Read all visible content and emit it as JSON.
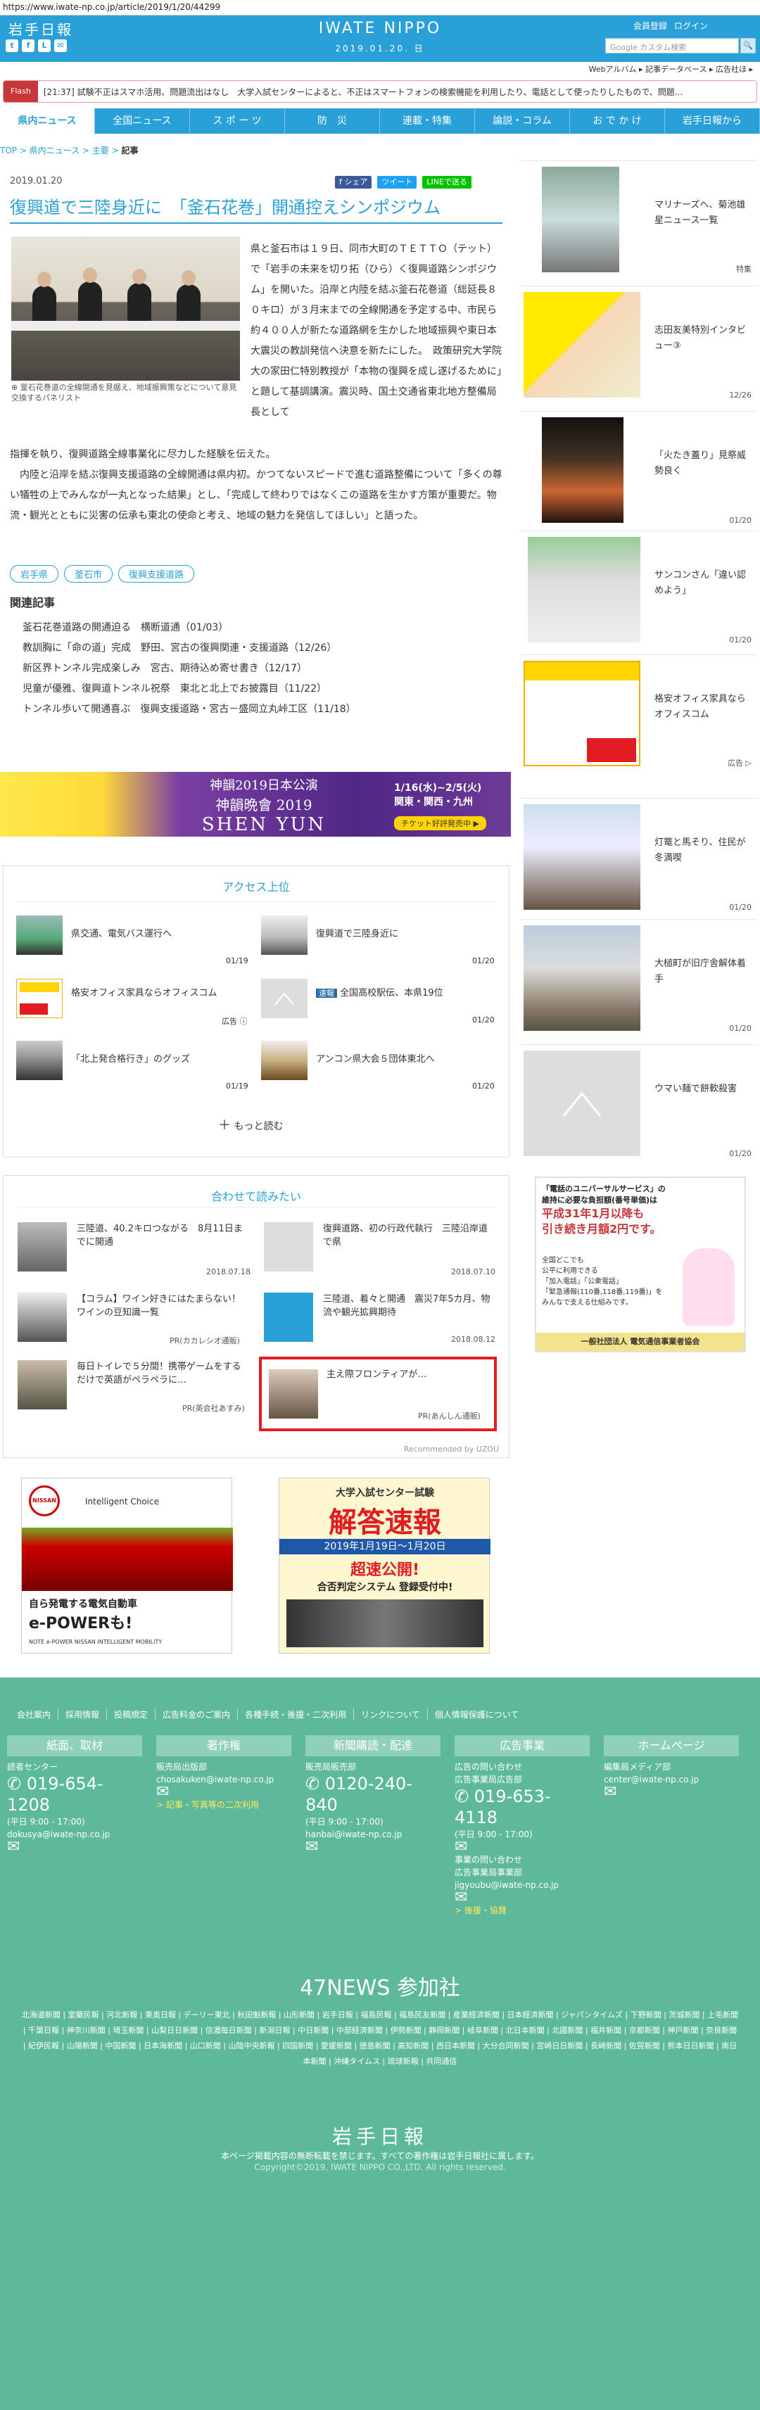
{
  "browser": {
    "url": "https://www.iwate-np.co.jp/article/2019/1/20/44299"
  },
  "header": {
    "logo": "岩手日報",
    "brand": "IWATE NIPPO",
    "date": "2019.01.20. 日",
    "links": [
      "会員登録",
      "ログイン"
    ],
    "search_placeholder": "Google カスタム検索",
    "search_button": "検索",
    "sublinks": "Webアルバム ▸ 記事データベース ▸ 広告社ほ ▸",
    "social_icons": [
      "twitter-icon",
      "facebook-icon",
      "line-icon",
      "mail-icon"
    ]
  },
  "flash": {
    "tag": "Flash",
    "text": "[21:37] 試験不正はスマホ活用、問題流出はなし　大学入試センターによると、不正はスマートフォンの検索機能を利用したり、電話として使ったりしたもので、問題..."
  },
  "nav": {
    "items": [
      "県内ニュース",
      "全国ニュース",
      "ス ポ ー ツ",
      "防　災",
      "連載・特集",
      "論説・コラム",
      "お で か け",
      "岩手日報から"
    ],
    "active_index": 0
  },
  "breadcrumb": {
    "items": [
      "TOP",
      "県内ニュース",
      "主要"
    ],
    "current": "記事"
  },
  "article": {
    "date": "2019.01.20",
    "share": [
      "f シェア",
      "ツイート",
      "LINEで送る"
    ],
    "title": "復興道で三陸身近に　「釜石花巻」開通控えシンポジウム",
    "caption": "釜石花巻道の全線開通を見据え、地域振興策などについて意見交換するパネリスト",
    "body1": "県と釜石市は１９日、同市大町のＴＥＴＴＯ（テット）で「岩手の未来を切り拓（ひら）く復興道路シンポジウム」を開いた。沿岸と内陸を結ぶ釜石花巻道（総延長８０キロ）が３月末までの全線開通を予定する中、市民ら約４００人が新たな道路網を生かした地域振興や東日本大震災の教訓発信へ決意を新たにした。　政策研究大学院大の家田仁特別教授が「本物の復興を成し遂げるために」と題して基調講演。震災時、国土交通省東北地方整備局長として",
    "body2": "指揮を執り、復興道路全線事業化に尽力した経験を伝えた。\n　内陸と沿岸を結ぶ復興支援道路の全線開通は県内初。かつてないスピードで進む道路整備について「多くの尊い犠牲の上でみんなが一丸となった結果」とし、「完成して終わりではなくこの道路を生かす方策が重要だ。物流・観光とともに災害の伝承も東北の使命と考え、地域の魅力を発信してほしい」と語った。",
    "tags": [
      "岩手県",
      "釜石市",
      "復興支援道路"
    ],
    "related_title": "関連記事",
    "related": [
      "釜石花巻道路の開通迫る　横断道通（01/03）",
      "教訓胸に「命の道」完成　野田、宮古の復興関連・支援道路（12/26）",
      "新区界トンネル完成楽しみ　宮古、期待込め寄せ書き（12/17）",
      "児童が優雅、復興道トンネル祝祭　東北と北上でお披露目（11/22）",
      "トンネル歩いて開通喜ぶ　復興支援道路・宮古－盛岡立丸峠工区（11/18）"
    ]
  },
  "banner": {
    "title": "神韻2019日本公演",
    "subtitle": "神韻晩會 2019",
    "name": "SHEN YUN",
    "dates": "1/16(水)~2/5(火)",
    "region": "関東・関西・九州",
    "button": "チケット好評発売中 ▶"
  },
  "access": {
    "title": "アクセス上位",
    "items": [
      {
        "text": "県交通、電気バス運行へ",
        "date": "01/19",
        "badge": ""
      },
      {
        "text": "復興道で三陸身近に",
        "date": "01/20",
        "badge": ""
      },
      {
        "text": "格安オフィス家具ならオフィスコム",
        "date": "広告 ⓘ",
        "badge": ""
      },
      {
        "text": "全国高校駅伝、本県19位",
        "date": "01/20",
        "badge": "速報"
      },
      {
        "text": "「北上発合格行き」のグッズ",
        "date": "01/19",
        "badge": ""
      },
      {
        "text": "アンコン県大会５団体東北へ",
        "date": "01/20",
        "badge": ""
      }
    ],
    "more": "もっと読む"
  },
  "also": {
    "title": "合わせて読みたい",
    "items": [
      {
        "text": "三陸道、40.2キロつながる　8月11日までに開通",
        "meta": "2018.07.18"
      },
      {
        "text": "復興道路、初の行政代執行　三陸沿岸道で県",
        "meta": "2018.07.10"
      },
      {
        "text": "【コラム】ワイン好きにはたまらない！ワインの豆知識一覧",
        "meta": "PR(カカレシオ通販)"
      },
      {
        "text": "三陸道、着々と開通　震災7年5カ月、物流や観光拡興期待",
        "meta": "2018.08.12"
      },
      {
        "text": "毎日トイレで５分間！携帯ゲームをするだけで英語がペラペラに…",
        "meta": "PR(英会社あすみ)"
      },
      {
        "text": "主え際フロンティアが…",
        "meta": "PR(あんしん通販)"
      }
    ],
    "recommended": "Recommended by UZOU"
  },
  "sidebar": [
    {
      "text": "マリナーズへ、菊池雄星ニュース一覧",
      "date": "特集"
    },
    {
      "text": "志田友美特別インタビュー③",
      "date": "12/26"
    },
    {
      "text": "「火たき蓋り」見祭威勢良く",
      "date": "01/20"
    },
    {
      "text": "サンコンさん「違い認めよう」",
      "date": "01/20"
    },
    {
      "text": "格安オフィス家具ならオフィスコム",
      "date": "広告 ▷"
    },
    {
      "text": "灯篭と馬そり、住民が冬満喫",
      "date": "01/20"
    },
    {
      "text": "大槌町が旧庁舎解体着手",
      "date": "01/20"
    },
    {
      "text": "ウマい麺で餅軟殺害",
      "date": "01/20"
    }
  ],
  "ads": {
    "side_ad": {
      "lines": [
        "「電話のユニバーサルサービス」の",
        "維持に必要な負担額(番号単価)は",
        "平成31年1月以降も",
        "引き続き月額2円です。"
      ],
      "small": [
        "全国どこでも",
        "公平に利用できる",
        "「加入電話」「公衆電話」",
        "「緊急通報(110番,118番,119番)」を",
        "みんなで支える仕組みです。"
      ],
      "footer": "一般社団法人 電気通信事業者協会"
    },
    "nissan": {
      "brand": "NISSAN",
      "headline": "Intelligent Choice",
      "copy": "自ら発電する電気自動車",
      "product": "e-POWERも!",
      "footer": "NOTE e-POWER   NISSAN INTELLIGENT MOBILITY"
    },
    "exam": {
      "top": "大学入試センター試験",
      "main": "解答速報",
      "dates": "2019年1月19日〜1月20日",
      "status": "超速公開!",
      "bottom": "合否判定システム 登録受付中!"
    }
  },
  "footer": {
    "links": [
      "会社案内",
      "採用情報",
      "投稿規定",
      "広告料金のご案内",
      "各種手続・後援・二次利用",
      "リンクについて",
      "個人情報保護について"
    ],
    "columns": [
      {
        "head": "紙面、取材",
        "lines": [
          "読者センター"
        ],
        "tel": "019-654-1208",
        "hours": "(平日 9:00 - 17:00)",
        "mail": "dokusya@iwate-np.co.jp"
      },
      {
        "head": "著作権",
        "lines": [
          "販売局出版部"
        ],
        "tel": "",
        "hours": "",
        "mail": "chosakuken@iwate-np.co.jp",
        "extra": "> 記事・写真等の二次利用"
      },
      {
        "head": "新聞購読・配達",
        "lines": [
          "販売局販売部"
        ],
        "tel": "0120-240-840",
        "hours": "(平日 9:00 - 17:00)",
        "mail": "hanbai@iwate-np.co.jp"
      },
      {
        "head": "広告事業",
        "lines": [
          "広告の問い合わせ",
          "広告事業局広告部"
        ],
        "tel": "019-653-4118",
        "hours": "(平日 9:00 - 17:00)",
        "mail": "",
        "extra2": [
          "事業の問い合わせ",
          "広告事業局事業部",
          "jigyoubu@iwate-np.co.jp"
        ],
        "extra": "> 後援・協賛"
      },
      {
        "head": "ホームページ",
        "lines": [
          "編集局メディア部"
        ],
        "tel": "",
        "hours": "",
        "mail": "center@iwate-np.co.jp"
      }
    ],
    "news47": "47NEWS 参加社",
    "papers": "北海道新聞 | 室蘭民報 | 河北新報 | 東奥日報 | デーリー東北 | 秋田魁新報 | 山形新聞 | 岩手日報 | 福島民報 | 福島民友新聞 | 産業経済新聞 | 日本経済新聞 | ジャパンタイムズ | 下野新聞 | 茨城新聞 | 上毛新聞 | 千葉日報 | 神奈川新聞 | 埼玉新聞 | 山梨日日新聞 | 信濃毎日新聞 | 新潟日報 | 中日新聞 | 中部経済新聞 | 伊勢新聞 | 静岡新聞 | 岐阜新聞 | 北日本新聞 | 北國新聞 | 福井新聞 | 京都新聞 | 神戸新聞 | 奈良新聞 | 紀伊民報 | 山陽新聞 | 中国新聞 | 日本海新聞 | 山口新聞 | 山陰中央新報 | 四国新聞 | 愛媛新聞 | 徳島新聞 | 高知新聞 | 西日本新聞 | 大分合同新聞 | 宮崎日日新聞 | 長崎新聞 | 佐賀新聞 | 熊本日日新聞 | 南日本新聞 | 沖縄タイムス | 琉球新報 | 共同通信",
    "logo": "岩手日報",
    "note": "本ページ掲載内容の無断転載を禁じます。すべての著作権は岩手日報社に属します。",
    "copyright": "Copyright©2019, IWATE NIPPO CO.,LTD. All rights reserved."
  },
  "colors": {
    "brand": "#2aa0d8",
    "footer": "#5eb99c",
    "flash": "#c8363a",
    "highlight": "#e31b23"
  }
}
